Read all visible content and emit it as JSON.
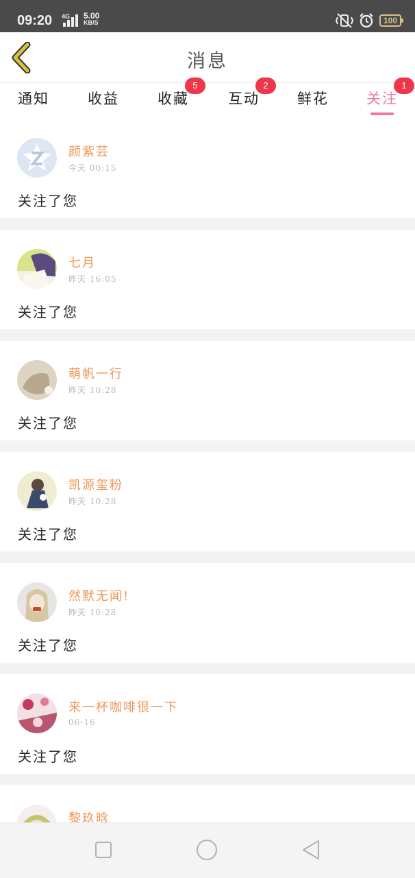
{
  "status_bar": {
    "time": "09:20",
    "network": "4G",
    "speed_value": "5.00",
    "speed_unit": "KB/S",
    "battery": "100",
    "icons": [
      "vibrate-off-icon",
      "alarm-icon",
      "battery-icon"
    ]
  },
  "header": {
    "title": "消息",
    "back_icon": "chevron-left-icon"
  },
  "tabs": [
    {
      "label": "通知",
      "badge": ""
    },
    {
      "label": "收益",
      "badge": ""
    },
    {
      "label": "收藏",
      "badge": "5"
    },
    {
      "label": "互动",
      "badge": "2"
    },
    {
      "label": "鲜花",
      "badge": ""
    },
    {
      "label": "关注",
      "badge": "1",
      "active": true
    }
  ],
  "messages": [
    {
      "name": "颜紫芸",
      "time": "今天 00:15",
      "text": "关注了您"
    },
    {
      "name": "七月",
      "time": "昨天 16:05",
      "text": "关注了您"
    },
    {
      "name": "萌帆一行",
      "time": "昨天 10:28",
      "text": "关注了您"
    },
    {
      "name": "凯源玺粉",
      "time": "昨天 10:28",
      "text": "关注了您"
    },
    {
      "name": "然默无闻!",
      "time": "昨天 10:28",
      "text": "关注了您"
    },
    {
      "name": "来一杯咖啡很一下",
      "time": "06-16",
      "text": "关注了您"
    },
    {
      "name": "黎玖晗",
      "time": "",
      "text": ""
    }
  ],
  "nav_bar": {
    "icons": [
      "recent-apps-icon",
      "home-icon",
      "back-triangle-icon"
    ]
  },
  "colors": {
    "accent": "#ec78a8",
    "name": "#ef9556",
    "badge": "#f0364a",
    "back_chevron": "#d9c040"
  }
}
